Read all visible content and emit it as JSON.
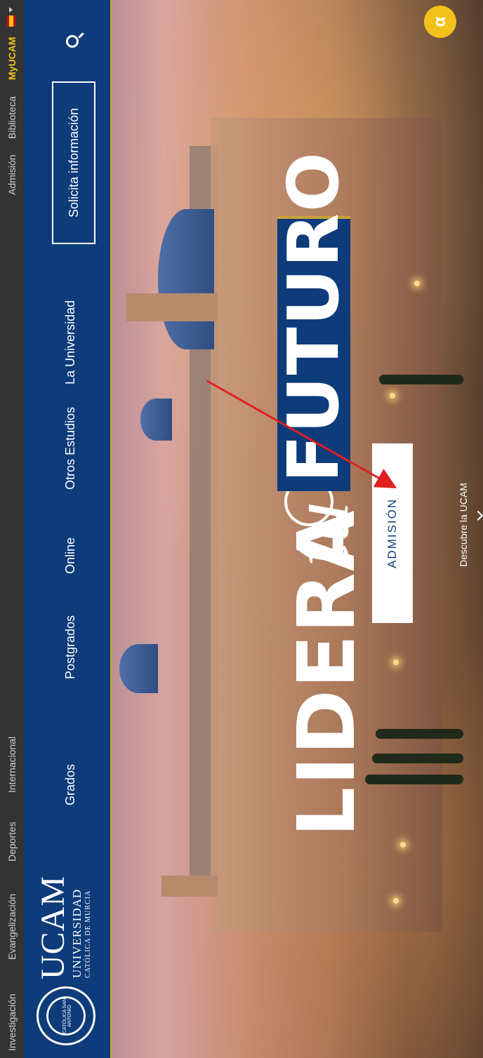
{
  "utility_bar": {
    "items": [
      "Investigación",
      "Evangelización",
      "Deportes",
      "Internacional",
      "Admisión",
      "Biblioteca",
      "MyUCAM"
    ]
  },
  "logo": {
    "seal_text": "CATÓLICA SAN ANTONIO",
    "word": "UCAM",
    "sub1": "UNIVERSIDAD",
    "sub2": "CATÓLICA DE MURCIA"
  },
  "nav": {
    "items": [
      "Grados",
      "Postgrados",
      "Online",
      "Otros Estudios",
      "La Universidad"
    ],
    "cta": "Solicita información"
  },
  "hero": {
    "word1": "LIDERA",
    "word2": "tu",
    "word3": "FUTURO",
    "button": "ADMISIÓN",
    "discover": "Descubre la UCAM"
  },
  "colors": {
    "brand_blue": "#0e3b7a",
    "gold": "#c8a23a",
    "myucam": "#f2c21a",
    "utility_bg": "#333333",
    "annotation": "#e02020"
  },
  "icons": {
    "search": "search-icon",
    "chat": "chat-icon",
    "flag": "spain-flag-icon"
  }
}
